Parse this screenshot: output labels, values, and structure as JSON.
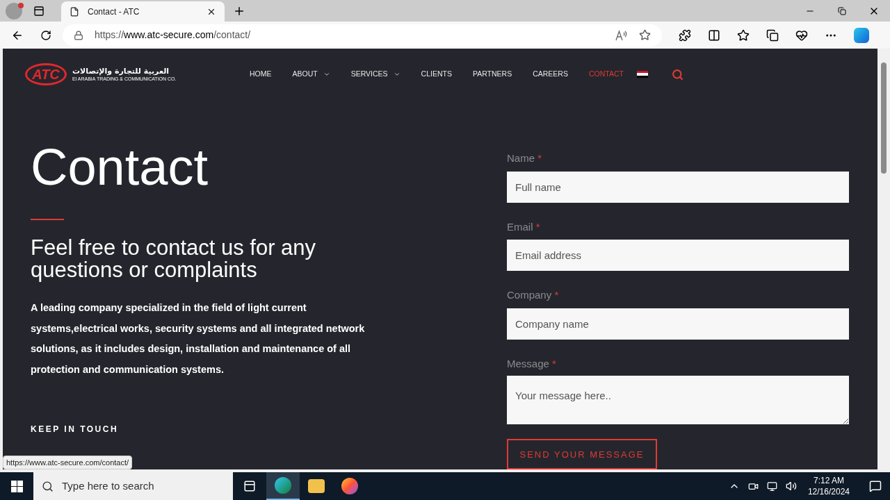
{
  "browser": {
    "tab_title": "Contact - ATC",
    "url_host": "https://www.atc-secure.com",
    "url_path": "/contact/",
    "status_url": "https://www.atc-secure.com/contact/"
  },
  "site": {
    "logo": {
      "mark": "ATC",
      "arabic": "العربية للتجارة والإتصالات",
      "english": "El ARABIA TRADING & COMMUNICATION CO."
    },
    "nav": [
      {
        "label": "HOME",
        "selected": false,
        "dropdown": false
      },
      {
        "label": "ABOUT",
        "selected": false,
        "dropdown": true
      },
      {
        "label": "SERVICES",
        "selected": false,
        "dropdown": true
      },
      {
        "label": "CLIENTS",
        "selected": false,
        "dropdown": false
      },
      {
        "label": "PARTNERS",
        "selected": false,
        "dropdown": false
      },
      {
        "label": "CAREERS",
        "selected": false,
        "dropdown": false
      },
      {
        "label": "CONTACT",
        "selected": true,
        "dropdown": false
      }
    ]
  },
  "hero": {
    "title": "Contact",
    "subtitle": "Feel free to contact us for any questions or complaints",
    "description": "A leading company specialized in the field of light current systems,electrical works, security systems and all integrated network solutions, as it includes design, installation and maintenance of all protection and communication systems.",
    "keep_in_touch": "KEEP IN TOUCH"
  },
  "form": {
    "fields": [
      {
        "label": "Name",
        "required": "*",
        "placeholder": "Full name",
        "kind": "input"
      },
      {
        "label": "Email",
        "required": "*",
        "placeholder": "Email address",
        "kind": "input"
      },
      {
        "label": "Company",
        "required": "*",
        "placeholder": "Company name",
        "kind": "input"
      },
      {
        "label": "Message",
        "required": "*",
        "placeholder": "Your message here..",
        "kind": "textarea"
      }
    ],
    "submit": "SEND YOUR MESSAGE"
  },
  "taskbar": {
    "search_placeholder": "Type here to search",
    "time": "7:12 AM",
    "date": "12/16/2024"
  }
}
